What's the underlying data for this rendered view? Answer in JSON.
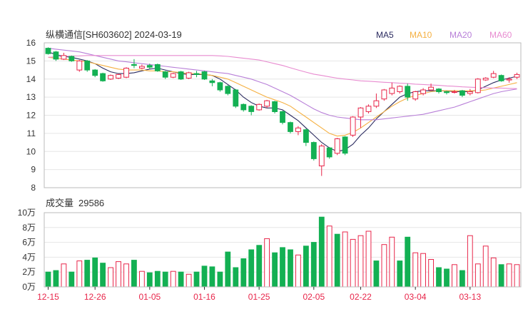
{
  "header": {
    "title": "纵横通信[SH603602] 2024-03-19"
  },
  "legend": [
    {
      "label": "MA5",
      "color": "#2b2b60"
    },
    {
      "label": "MA10",
      "color": "#f5b041"
    },
    {
      "label": "MA20",
      "color": "#b87fd8"
    },
    {
      "label": "MA60",
      "color": "#e88bd0"
    }
  ],
  "volume_panel": {
    "label": "成交量",
    "value": "29586"
  },
  "colors": {
    "up": "#e8264a",
    "down": "#13b053",
    "grid": "#e6e6e6",
    "axis": "#333333",
    "date_label": "#e8264a"
  },
  "chart_data": [
    {
      "type": "candlestick",
      "title": "纵横通信[SH603602] 2024-03-19",
      "ylim": [
        8,
        16
      ],
      "y_ticks": [
        8,
        9,
        10,
        11,
        12,
        13,
        14,
        15,
        16
      ],
      "x_tick_labels": [
        {
          "label": "12-15",
          "index": 0
        },
        {
          "label": "12-26",
          "index": 6
        },
        {
          "label": "01-05",
          "index": 13
        },
        {
          "label": "01-16",
          "index": 20
        },
        {
          "label": "01-25",
          "index": 27
        },
        {
          "label": "02-05",
          "index": 34
        },
        {
          "label": "02-22",
          "index": 40
        },
        {
          "label": "03-04",
          "index": 47
        },
        {
          "label": "03-13",
          "index": 54
        }
      ],
      "candles": [
        [
          15.7,
          15.4,
          15.75,
          15.35
        ],
        [
          15.5,
          15.1,
          15.55,
          15.0
        ],
        [
          15.1,
          15.3,
          15.45,
          15.05
        ],
        [
          15.25,
          15.0,
          15.3,
          14.95
        ],
        [
          14.5,
          15.0,
          15.05,
          14.4
        ],
        [
          15.0,
          14.5,
          15.05,
          14.4
        ],
        [
          14.5,
          14.2,
          14.55,
          14.1
        ],
        [
          14.3,
          13.9,
          14.35,
          13.85
        ],
        [
          14.0,
          14.2,
          14.25,
          13.95
        ],
        [
          14.05,
          14.25,
          14.3,
          14.0
        ],
        [
          14.1,
          14.6,
          14.65,
          14.05
        ],
        [
          14.8,
          14.75,
          15.1,
          14.6
        ],
        [
          14.6,
          14.7,
          14.8,
          14.55
        ],
        [
          14.75,
          14.65,
          14.85,
          14.55
        ],
        [
          14.8,
          14.45,
          14.85,
          14.4
        ],
        [
          14.4,
          14.1,
          14.45,
          14.0
        ],
        [
          14.1,
          14.3,
          14.35,
          14.05
        ],
        [
          14.4,
          14.0,
          14.45,
          13.95
        ],
        [
          14.05,
          14.35,
          14.4,
          14.0
        ],
        [
          14.3,
          14.25,
          14.45,
          14.1
        ],
        [
          14.4,
          14.0,
          14.45,
          13.95
        ],
        [
          13.9,
          13.8,
          14.0,
          13.6
        ],
        [
          13.8,
          13.4,
          13.85,
          13.3
        ],
        [
          13.6,
          13.2,
          13.65,
          13.1
        ],
        [
          13.4,
          12.5,
          13.45,
          12.4
        ],
        [
          12.6,
          12.3,
          12.65,
          12.2
        ],
        [
          12.5,
          12.2,
          12.55,
          12.0
        ],
        [
          12.3,
          12.6,
          12.65,
          12.25
        ],
        [
          12.5,
          12.8,
          12.85,
          12.4
        ],
        [
          12.75,
          12.2,
          12.8,
          12.1
        ],
        [
          12.2,
          11.6,
          12.25,
          11.5
        ],
        [
          11.6,
          11.1,
          11.65,
          11.0
        ],
        [
          11.1,
          11.3,
          11.4,
          10.9
        ],
        [
          11.2,
          10.5,
          11.25,
          10.3
        ],
        [
          10.5,
          9.6,
          10.55,
          9.5
        ],
        [
          9.2,
          10.3,
          10.4,
          8.65
        ],
        [
          10.2,
          9.7,
          10.25,
          9.6
        ],
        [
          9.9,
          10.7,
          10.75,
          9.8
        ],
        [
          10.8,
          9.9,
          10.85,
          9.8
        ],
        [
          10.9,
          11.9,
          11.95,
          10.8
        ],
        [
          11.9,
          12.4,
          12.45,
          11.3
        ],
        [
          12.2,
          12.5,
          12.6,
          12.1
        ],
        [
          12.5,
          12.8,
          13.2,
          12.4
        ],
        [
          12.9,
          13.4,
          13.45,
          12.8
        ],
        [
          13.2,
          13.5,
          13.8,
          13.1
        ],
        [
          13.3,
          13.6,
          13.65,
          13.2
        ],
        [
          13.6,
          13.0,
          13.75,
          12.8
        ],
        [
          12.9,
          13.3,
          13.35,
          12.8
        ],
        [
          13.2,
          13.4,
          13.5,
          13.1
        ],
        [
          13.4,
          13.55,
          13.75,
          13.35
        ],
        [
          13.45,
          13.3,
          13.5,
          13.2
        ],
        [
          13.3,
          13.25,
          13.35,
          13.15
        ],
        [
          13.3,
          13.3,
          13.4,
          13.2
        ],
        [
          13.35,
          13.1,
          13.4,
          13.0
        ],
        [
          13.2,
          13.3,
          13.45,
          13.1
        ],
        [
          13.25,
          14.0,
          14.05,
          13.2
        ],
        [
          13.95,
          14.05,
          14.1,
          13.9
        ],
        [
          14.1,
          14.3,
          14.45,
          14.05
        ],
        [
          14.2,
          13.9,
          14.25,
          13.85
        ],
        [
          13.95,
          14.0,
          14.1,
          13.8
        ],
        [
          14.1,
          14.25,
          14.35,
          14.0
        ]
      ],
      "ma_lines": {
        "MA5": [
          15.5,
          15.35,
          15.25,
          15.2,
          15.1,
          15.0,
          14.85,
          14.6,
          14.4,
          14.3,
          14.3,
          14.35,
          14.45,
          14.55,
          14.6,
          14.5,
          14.4,
          14.3,
          14.25,
          14.25,
          14.25,
          14.2,
          14.0,
          13.7,
          13.4,
          13.0,
          12.7,
          12.5,
          12.4,
          12.4,
          12.3,
          12.0,
          11.7,
          11.3,
          10.9,
          10.5,
          10.2,
          10.0,
          10.1,
          10.4,
          10.9,
          11.3,
          11.8,
          12.2,
          12.6,
          13.0,
          13.2,
          13.3,
          13.35,
          13.35,
          13.35,
          13.35,
          13.3,
          13.3,
          13.3,
          13.4,
          13.6,
          13.8,
          13.95,
          14.05,
          14.15
        ],
        "MA10": [
          15.2,
          15.15,
          15.1,
          15.05,
          15.0,
          14.95,
          14.85,
          14.75,
          14.65,
          14.55,
          14.5,
          14.5,
          14.5,
          14.45,
          14.45,
          14.4,
          14.4,
          14.35,
          14.3,
          14.3,
          14.25,
          14.2,
          14.1,
          14.0,
          13.8,
          13.6,
          13.4,
          13.2,
          13.0,
          12.85,
          12.7,
          12.5,
          12.2,
          11.9,
          11.6,
          11.3,
          11.0,
          10.85,
          10.9,
          11.05,
          11.3,
          11.6,
          11.9,
          12.2,
          12.5,
          12.75,
          12.95,
          13.1,
          13.2,
          13.3,
          13.35,
          13.35,
          13.35,
          13.35,
          13.35,
          13.35,
          13.4,
          13.5,
          13.6,
          13.7,
          13.8
        ],
        "MA20": [
          15.7,
          15.65,
          15.6,
          15.55,
          15.5,
          15.4,
          15.3,
          15.2,
          15.1,
          15.0,
          14.95,
          14.9,
          14.85,
          14.8,
          14.75,
          14.7,
          14.65,
          14.6,
          14.55,
          14.5,
          14.45,
          14.4,
          14.35,
          14.3,
          14.2,
          14.1,
          14.0,
          13.85,
          13.7,
          13.5,
          13.3,
          13.1,
          12.85,
          12.6,
          12.35,
          12.15,
          12.0,
          11.9,
          11.85,
          11.8,
          11.75,
          11.75,
          11.75,
          11.8,
          11.85,
          11.9,
          11.95,
          12.0,
          12.05,
          12.15,
          12.25,
          12.35,
          12.45,
          12.6,
          12.75,
          12.9,
          13.05,
          13.2,
          13.3,
          13.38,
          13.45
        ],
        "MA60": [
          15.2,
          15.23,
          15.25,
          15.27,
          15.28,
          15.3,
          15.3,
          15.3,
          15.3,
          15.3,
          15.3,
          15.3,
          15.3,
          15.3,
          15.3,
          15.3,
          15.3,
          15.3,
          15.3,
          15.3,
          15.3,
          15.3,
          15.28,
          15.25,
          15.2,
          15.15,
          15.1,
          15.05,
          14.95,
          14.85,
          14.75,
          14.62,
          14.5,
          14.38,
          14.27,
          14.2,
          14.12,
          14.05,
          14.0,
          13.95,
          13.9,
          13.88,
          13.85,
          13.82,
          13.8,
          13.77,
          13.75,
          13.72,
          13.7,
          13.67,
          13.65,
          13.62,
          13.6,
          13.57,
          13.55,
          13.53,
          13.52,
          13.5,
          13.5,
          13.48,
          13.47
        ]
      }
    },
    {
      "type": "bar",
      "title": "成交量 29586",
      "ylim": [
        0,
        100000
      ],
      "y_tick_labels": [
        "0万",
        "2万",
        "4万",
        "6万",
        "8万",
        "10万"
      ],
      "values": [
        20000,
        22000,
        31000,
        20000,
        35000,
        36000,
        39000,
        32000,
        26000,
        34000,
        31000,
        36000,
        21000,
        19000,
        21000,
        20000,
        21000,
        20000,
        17000,
        20000,
        28000,
        27000,
        20000,
        47000,
        26000,
        38000,
        50000,
        56000,
        65000,
        46000,
        53000,
        50000,
        43000,
        55000,
        60000,
        94000,
        82000,
        71000,
        74000,
        64000,
        69000,
        75000,
        35000,
        57000,
        67000,
        35000,
        67000,
        46000,
        45000,
        37000,
        26000,
        24000,
        30000,
        22000,
        69000,
        31000,
        55000,
        39000,
        30000,
        31000,
        30000
      ],
      "directions": [
        "down",
        "down",
        "up",
        "down",
        "up",
        "down",
        "down",
        "down",
        "up",
        "up",
        "up",
        "down",
        "up",
        "down",
        "down",
        "down",
        "up",
        "down",
        "up",
        "down",
        "down",
        "down",
        "down",
        "down",
        "down",
        "down",
        "down",
        "down",
        "up",
        "down",
        "down",
        "down",
        "up",
        "down",
        "down",
        "down",
        "up",
        "down",
        "up",
        "up",
        "up",
        "up",
        "down",
        "up",
        "up",
        "down",
        "down",
        "up",
        "up",
        "up",
        "down",
        "down",
        "up",
        "down",
        "up",
        "up",
        "up",
        "up",
        "down",
        "up",
        "up"
      ]
    }
  ]
}
